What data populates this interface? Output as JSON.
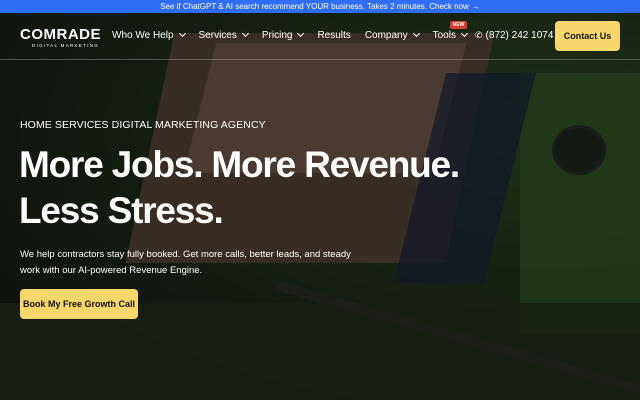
{
  "announcement": {
    "text": "See if ChatGPT & AI search recommend YOUR business. Takes 2 minutes. Check now",
    "arrow": "→"
  },
  "brand": {
    "name": "COMRADE",
    "tagline": "DIGITAL MARKETING"
  },
  "nav": {
    "items": [
      {
        "label": "Who We Help",
        "dropdown": true
      },
      {
        "label": "Services",
        "dropdown": true
      },
      {
        "label": "Pricing",
        "dropdown": true
      },
      {
        "label": "Results",
        "dropdown": false
      },
      {
        "label": "Company",
        "dropdown": true
      },
      {
        "label": "Tools",
        "dropdown": true,
        "badge": "NEW"
      }
    ],
    "phone": "(872) 242 1074",
    "contact_label": "Contact Us"
  },
  "hero": {
    "eyebrow": "HOME SERVICES DIGITAL MARKETING AGENCY",
    "headline_line1": "More Jobs. More Revenue.",
    "headline_line2": "Less Stress.",
    "subtext": "We help contractors stay fully booked. Get more calls, better leads, and steady work with our AI-powered Revenue Engine.",
    "cta_label": "Book My Free Growth Call"
  },
  "colors": {
    "announcement_bg": "#2f6df6",
    "accent_button": "#f7d66b",
    "badge": "#d93a2b"
  },
  "icons": {
    "phone": "phone-icon",
    "dropdown": "chevron-down-icon"
  }
}
